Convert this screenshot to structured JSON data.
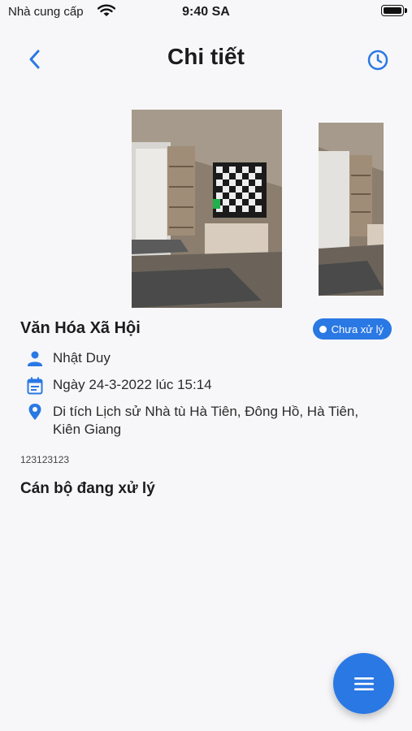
{
  "status_bar": {
    "carrier": "Nhà cung cấp",
    "time": "9:40 SA"
  },
  "header": {
    "title": "Chi tiết",
    "back_icon": "chevron-left-icon",
    "history_icon": "clock-icon"
  },
  "photos": [
    {
      "name": "living-room-photo-1"
    },
    {
      "name": "living-room-photo-2"
    }
  ],
  "detail": {
    "category": "Văn Hóa Xã Hội",
    "status": "Chưa xử lý",
    "reporter": "Nhật Duy",
    "date": "Ngày 24-3-2022 lúc 15:14",
    "location": "Di tích Lịch sử Nhà tù Hà Tiên, Đông Hồ, Hà Tiên, Kiên Giang",
    "code": "123123123"
  },
  "handlers_section": {
    "title": "Cán bộ đang xử lý"
  },
  "fab": {
    "icon": "menu-icon"
  },
  "colors": {
    "accent": "#2a78e4",
    "background": "#f7f7f9"
  }
}
